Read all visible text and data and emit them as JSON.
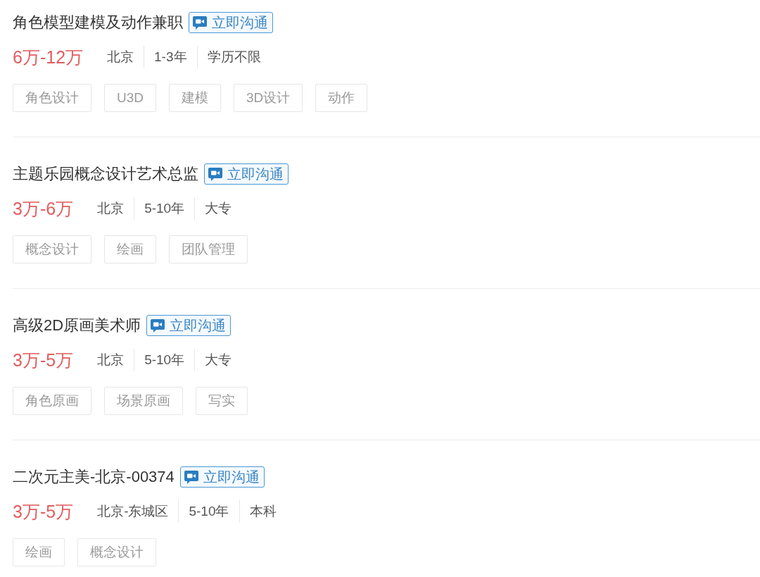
{
  "jobs": [
    {
      "title": "角色模型建模及动作兼职",
      "chat_button": "立即沟通",
      "salary": "6万-12万",
      "meta": [
        "北京",
        "1-3年",
        "学历不限"
      ],
      "tags": [
        "角色设计",
        "U3D",
        "建模",
        "3D设计",
        "动作"
      ]
    },
    {
      "title": "主题乐园概念设计艺术总监",
      "chat_button": "立即沟通",
      "salary": "3万-6万",
      "meta": [
        "北京",
        "5-10年",
        "大专"
      ],
      "tags": [
        "概念设计",
        "绘画",
        "团队管理"
      ]
    },
    {
      "title": "高级2D原画美术师",
      "chat_button": "立即沟通",
      "salary": "3万-5万",
      "meta": [
        "北京",
        "5-10年",
        "大专"
      ],
      "tags": [
        "角色原画",
        "场景原画",
        "写实"
      ]
    },
    {
      "title": "二次元主美-北京-00374",
      "chat_button": "立即沟通",
      "salary": "3万-5万",
      "meta": [
        "北京-东城区",
        "5-10年",
        "本科"
      ],
      "tags": [
        "绘画",
        "概念设计"
      ]
    }
  ]
}
